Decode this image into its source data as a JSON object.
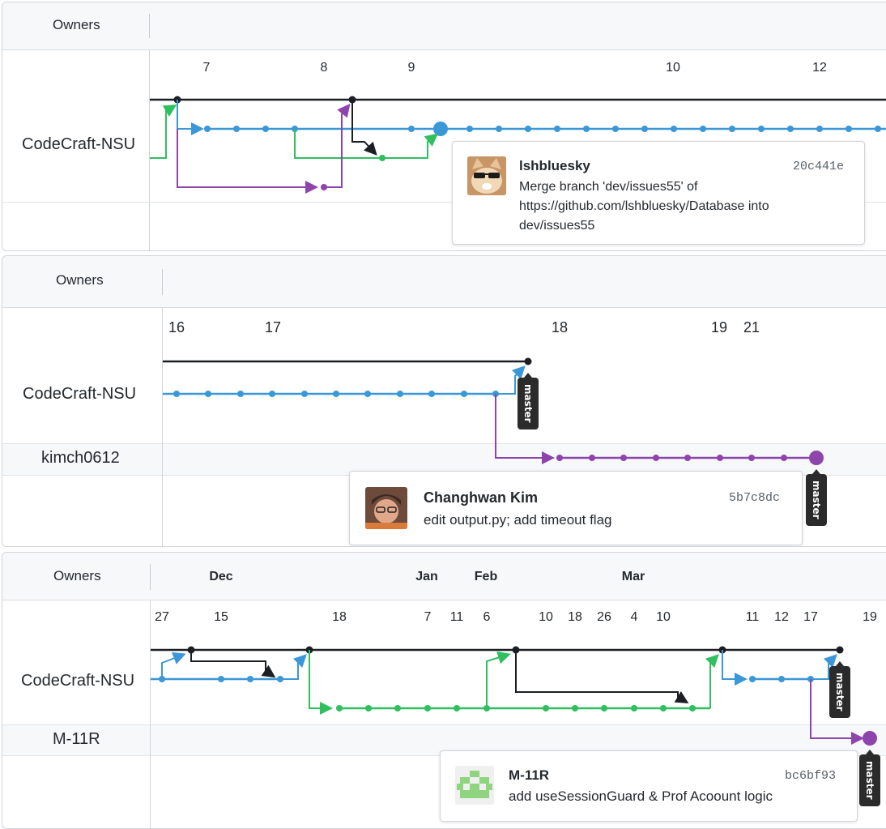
{
  "colors": {
    "black_branch": "#1b1f23",
    "blue_branch": "#3a97d8",
    "green_branch": "#2fbf5f",
    "purple_branch": "#8e44ad",
    "header_bg": "#f6f8fa"
  },
  "panel1": {
    "owners_label": "Owners",
    "row_owner": "CodeCraft-NSU",
    "ticks": [
      "7",
      "8",
      "9",
      "10",
      "12"
    ],
    "card": {
      "avatar": "cat-with-sunglasses-avatar",
      "author": "lshbluesky",
      "sha": "20c441e",
      "message_lines": [
        "Merge branch 'dev/issues55' of",
        "https://github.com/lshbluesky/Database into",
        "dev/issues55"
      ]
    }
  },
  "panel2": {
    "owners_label": "Owners",
    "row_owner_1": "CodeCraft-NSU",
    "row_owner_2": "kimch0612",
    "ticks": [
      "16",
      "17",
      "18",
      "19",
      "21"
    ],
    "branch_label_1": "master",
    "branch_label_2": "master",
    "card": {
      "avatar": "person-avatar",
      "author": "Changhwan Kim",
      "sha": "5b7c8dc",
      "message": "edit output.py; add timeout flag"
    }
  },
  "panel3": {
    "owners_label": "Owners",
    "months": [
      "Dec",
      "Jan",
      "Feb",
      "Mar"
    ],
    "ticks": [
      "27",
      "15",
      "18",
      "7",
      "11",
      "6",
      "10",
      "18",
      "26",
      "4",
      "10",
      "11",
      "12",
      "17",
      "19"
    ],
    "row_owner_1": "CodeCraft-NSU",
    "row_owner_2": "M-11R",
    "branch_label_1": "master",
    "branch_label_2": "master",
    "card": {
      "avatar": "green-identicon-avatar",
      "author": "M-11R",
      "sha": "bc6bf93",
      "message": "add useSessionGuard & Prof Acoount logic"
    }
  }
}
